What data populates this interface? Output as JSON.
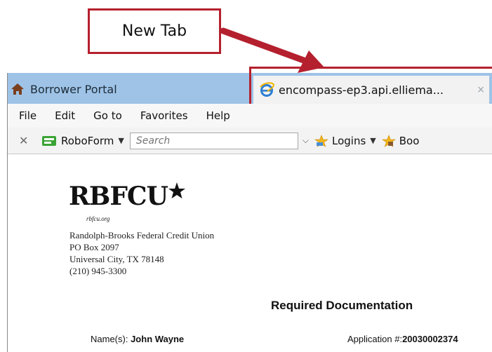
{
  "callout": {
    "label": "New Tab"
  },
  "tabs": [
    {
      "title": "Borrower Portal",
      "icon": "home-icon"
    },
    {
      "title": "encompass-ep3.api.elliema...",
      "icon": "ie-icon",
      "close": "×"
    }
  ],
  "menu": [
    "File",
    "Edit",
    "Go to",
    "Favorites",
    "Help"
  ],
  "toolbar": {
    "close": "✕",
    "roboform_label": "RoboForm",
    "dropdown_caret": "▼",
    "search_placeholder": "Search",
    "search_chevron": "⌵",
    "logins_label": "Logins",
    "bookmarks_label": "Boo"
  },
  "document": {
    "logo_text": "RBFCU",
    "logo_sub": "rbfcu.org",
    "address": [
      "Randolph-Brooks Federal Credit Union",
      "PO Box 2097",
      "Universal City, TX 78148",
      "(210) 945-3300"
    ],
    "heading": "Required Documentation",
    "names_label": "Name(s):",
    "names_value": "John Wayne",
    "application_label": "Application #:",
    "application_value": "20030002374"
  },
  "colors": {
    "highlight_red": "#b5202e",
    "tabstrip_blue": "#9ec3e6"
  }
}
